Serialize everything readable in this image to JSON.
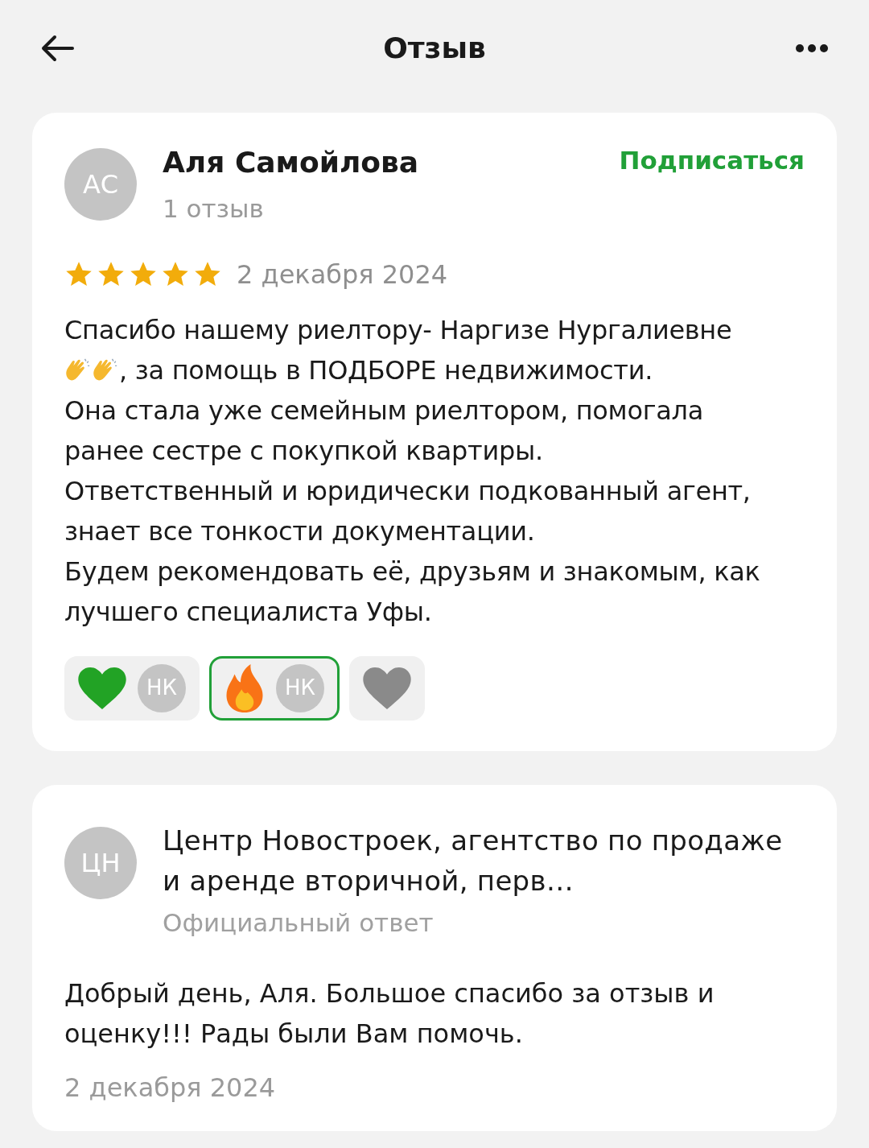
{
  "header": {
    "title": "Отзыв"
  },
  "review": {
    "author": {
      "initials": "АС",
      "name": "Аля Самойлова",
      "subtitle": "1 отзыв"
    },
    "subscribe": "Подписаться",
    "stars": 5,
    "date": "2 декабря 2024",
    "body": [
      {
        "parts": [
          {
            "kind": "text",
            "text": "Спасибо нашему риелтору- Наргизе Нургалиевне"
          }
        ]
      },
      {
        "parts": [
          {
            "kind": "clap"
          },
          {
            "kind": "clap"
          },
          {
            "kind": "text",
            "text": ", за помощь в ПОДБОРЕ недвижимости."
          }
        ]
      },
      {
        "parts": [
          {
            "kind": "text",
            "text": "Она стала уже семейным риелтором, помогала ранее сестре с покупкой квартиры.\nОтветственный и юридически подкованный агент, знает все тонкости документации.\nБудем рекомендовать её, друзьям и знакомым, как лучшего специалиста Уфы."
          }
        ]
      }
    ],
    "reactions": [
      {
        "kind": "heart",
        "color": "#22a325",
        "selected": false,
        "user": "НК"
      },
      {
        "kind": "fire",
        "color": "#f97316",
        "selected": true,
        "user": "НК"
      },
      {
        "kind": "heart",
        "color": "#8a8a8a",
        "selected": false
      }
    ]
  },
  "answer": {
    "author": {
      "initials": "ЦН",
      "name": "Центр Новостроек, агентство по продаже и аренде вторичной, перв…",
      "subtitle": "Официальный ответ"
    },
    "text": "Добрый день, Аля. Большое спасибо за отзыв и оценку!!! Рады были Вам помочь.",
    "date": "2 декабря 2024"
  }
}
